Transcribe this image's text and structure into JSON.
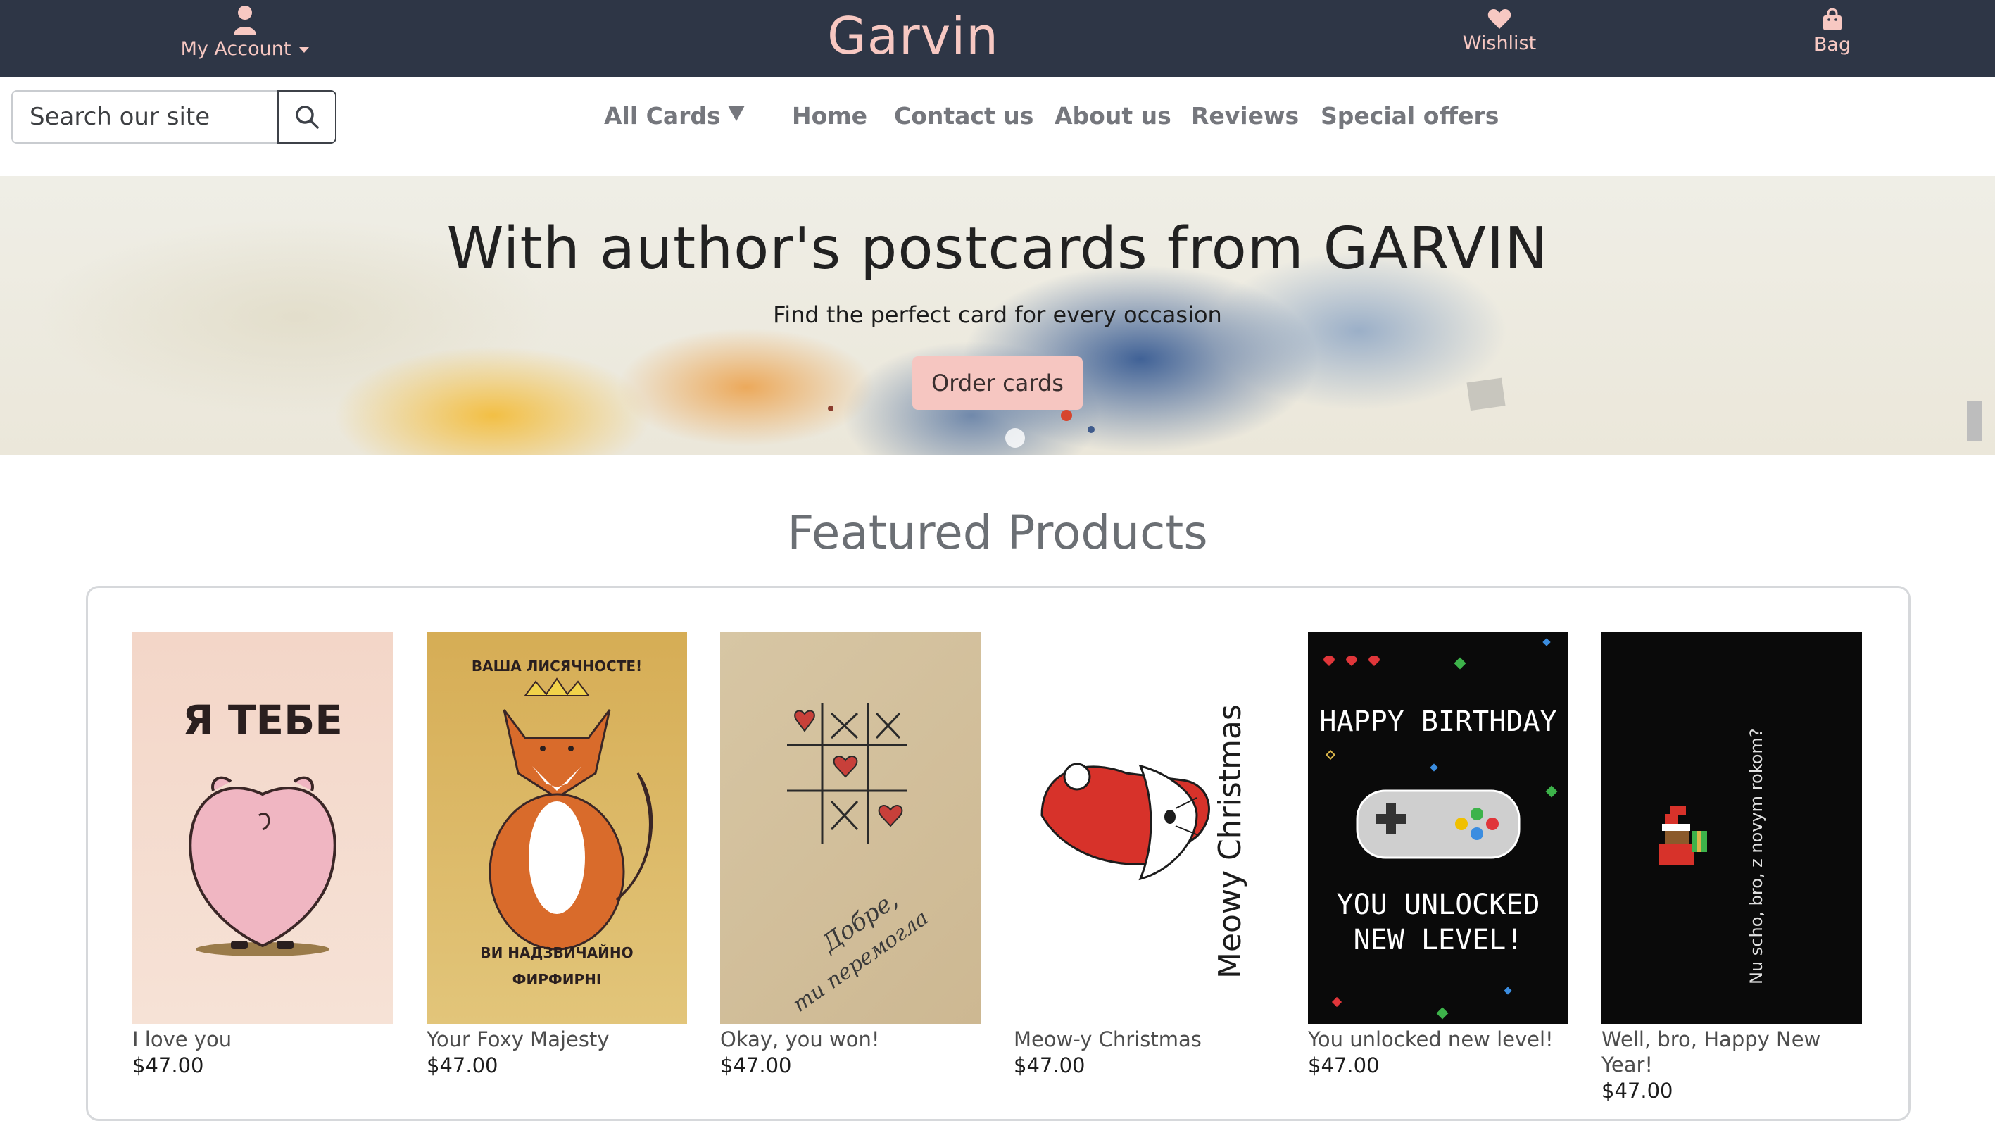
{
  "header": {
    "account_label": "My Account",
    "brand": "Garvin",
    "wishlist_label": "Wishlist",
    "bag_label": "Bag"
  },
  "search": {
    "placeholder": "Search our site"
  },
  "nav": {
    "all_cards": "All Cards",
    "links": [
      "Home",
      "Contact us",
      "About us",
      "Reviews",
      "Special offers"
    ]
  },
  "hero": {
    "title": "With author's postcards from GARVIN",
    "subtitle": "Find the perfect card for every occasion",
    "button": "Order cards"
  },
  "featured": {
    "title": "Featured Products",
    "products": [
      {
        "name": "I love you",
        "price": "$47.00",
        "card_text": [
          "Я ТЕБЕ"
        ]
      },
      {
        "name": "Your Foxy Majesty",
        "price": "$47.00",
        "card_text": [
          "ВАША ЛИСЯЧНОСТЕ!",
          "ВИ НАДЗВИЧАЙНО",
          "ФИРФИРНІ"
        ]
      },
      {
        "name": "Okay, you won!",
        "price": "$47.00",
        "card_text": [
          "Добре,",
          "ти перемогла"
        ]
      },
      {
        "name": "Meow-y Christmas",
        "price": "$47.00",
        "card_text": [
          "Meowy Christmas"
        ]
      },
      {
        "name": "You unlocked new level!",
        "price": "$47.00",
        "card_text": [
          "HAPPY BIRTHDAY",
          "YOU UNLOCKED",
          "NEW LEVEL!"
        ]
      },
      {
        "name": "Well, bro, Happy New Year!",
        "price": "$47.00",
        "card_text": [
          "Nu scho, bro, z novym rokom?"
        ]
      }
    ]
  },
  "colors": {
    "topbar_bg": "#2e3646",
    "accent_pink": "#f7c8c2",
    "button_pink": "#f6c6c1",
    "nav_text": "#75777d"
  }
}
